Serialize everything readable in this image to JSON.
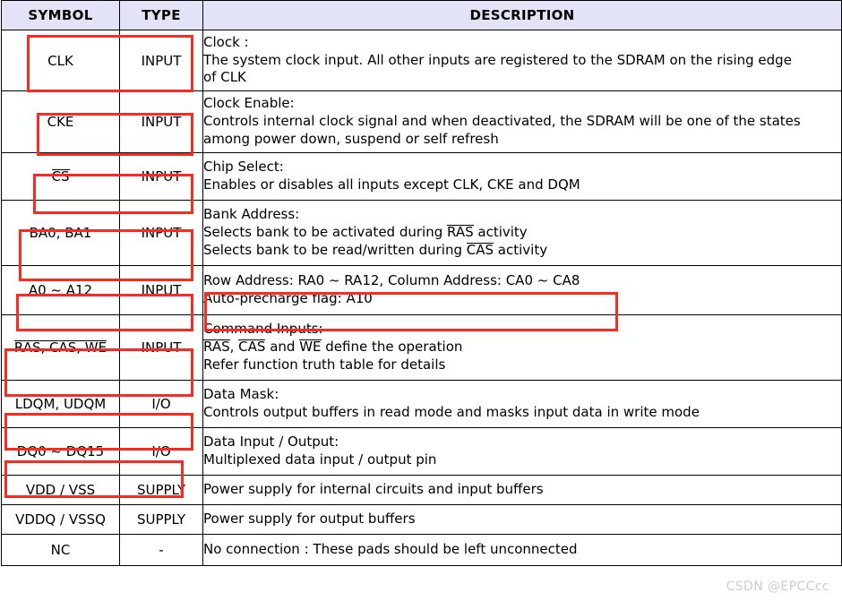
{
  "table": {
    "headers": {
      "symbol": "SYMBOL",
      "type": "TYPE",
      "description": "DESCRIPTION"
    },
    "header_bg": "#e3e3f8",
    "highlight_color": "#fa2a20",
    "rows": [
      {
        "symbol": "CLK",
        "symbol_overline": "",
        "type": "INPUT",
        "desc_lines": [
          "Clock :",
          "The system clock input. All other inputs are registered to the SDRAM on the rising edge",
          "of CLK"
        ]
      },
      {
        "symbol": "CKE",
        "symbol_overline": "",
        "type": "INPUT",
        "desc_lines": [
          "Clock Enable:",
          "Controls internal clock signal and when deactivated, the SDRAM will be one of the states",
          "among power down, suspend or self refresh"
        ]
      },
      {
        "symbol": "CS",
        "symbol_overline": "CS",
        "type": "INPUT",
        "desc_lines": [
          "Chip Select:",
          "Enables or disables all inputs except CLK, CKE and DQM"
        ]
      },
      {
        "symbol": "BA0, BA1",
        "symbol_overline": "",
        "type": "INPUT",
        "desc_lines": [
          "Bank Address:",
          "Selects bank to be activated during RAS activity",
          "Selects bank to be read/written during CAS activity"
        ]
      },
      {
        "symbol": "A0 ~ A12",
        "symbol_overline": "",
        "type": "INPUT",
        "desc_lines": [
          "Row Address: RA0 ~ RA12, Column Address: CA0 ~ CA8",
          "Auto-precharge flag: A10"
        ]
      },
      {
        "symbol": "RAS, CAS, WE",
        "symbol_overline": "RAS, CAS, WE",
        "type": "INPUT",
        "desc_lines": [
          "Command Inputs:",
          "RAS, CAS and WE define the operation",
          "Refer function truth table for details"
        ]
      },
      {
        "symbol": "LDQM, UDQM",
        "symbol_overline": "",
        "type": "I/O",
        "desc_lines": [
          "Data Mask:",
          "Controls output buffers in read mode and masks input data in write mode"
        ]
      },
      {
        "symbol": "DQ0 ~ DQ15",
        "symbol_overline": "",
        "type": "I/O",
        "desc_lines": [
          "Data Input / Output:",
          "Multiplexed data input / output pin"
        ]
      },
      {
        "symbol": "VDD / VSS",
        "symbol_overline": "",
        "type": "SUPPLY",
        "desc_lines": [
          "Power supply for internal circuits and input buffers"
        ]
      },
      {
        "symbol": "VDDQ / VSSQ",
        "symbol_overline": "",
        "type": "SUPPLY",
        "desc_lines": [
          "Power supply for output buffers"
        ]
      },
      {
        "symbol": "NC",
        "symbol_overline": "",
        "type": "-",
        "desc_lines": [
          "No connection : These pads should be left unconnected"
        ]
      }
    ]
  },
  "segments": {
    "ba_line2_pre": "Selects bank to be activated during ",
    "ba_line2_ovl": "RAS",
    "ba_line2_post": " activity",
    "ba_line3_pre": "Selects bank to be read/written during ",
    "ba_line3_ovl": "CAS",
    "ba_line3_post": " activity",
    "cmd_line2_ovl1": "RAS",
    "cmd_line2_sep1": ", ",
    "cmd_line2_ovl2": "CAS",
    "cmd_line2_sep2": " and ",
    "cmd_line2_ovl3": "WE",
    "cmd_line2_post": " define the operation"
  },
  "watermark": {
    "text": "CSDN @EPCCcc"
  }
}
